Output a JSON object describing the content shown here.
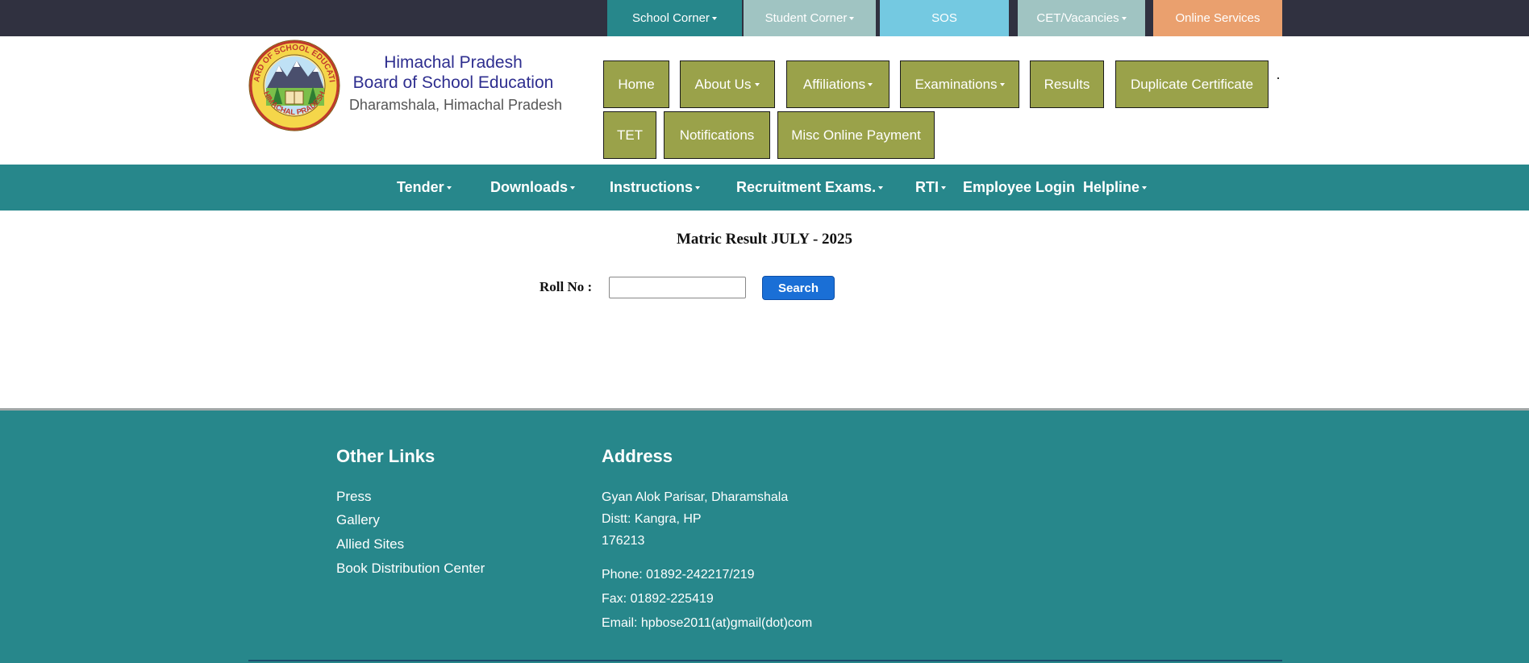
{
  "colors": {
    "topbar_bg": "#303140",
    "school_corner": "#27878b",
    "student_corner": "#a0c4c2",
    "sos": "#74c9e1",
    "cet": "#a0c4c2",
    "online": "#eaa06e",
    "nav_btn": "#9aa24a",
    "teal": "#27878b",
    "search_btn": "#1a6fd6"
  },
  "topbar": {
    "items": [
      {
        "label": "School Corner",
        "dropdown": true
      },
      {
        "label": "Student Corner",
        "dropdown": true
      },
      {
        "label": "SOS",
        "dropdown": false
      },
      {
        "label": "CET/Vacancies",
        "dropdown": true
      },
      {
        "label": "Online Services",
        "dropdown": false
      }
    ]
  },
  "brand": {
    "line1": "Himachal Pradesh",
    "line2": "Board of School Education",
    "line3": "Dharamshala, Himachal Pradesh",
    "logo_text_top": "BOARD OF SCHOOL EDUCATION",
    "logo_text_bottom": "HIMACHAL PRADESH"
  },
  "nav": {
    "items": [
      {
        "label": "Home",
        "dropdown": false
      },
      {
        "label": "About Us",
        "dropdown": true
      },
      {
        "label": "Affiliations",
        "dropdown": true
      },
      {
        "label": "Examinations",
        "dropdown": true
      },
      {
        "label": "Results",
        "dropdown": false
      },
      {
        "label": "Duplicate Certificate",
        "dropdown": false
      },
      {
        "label": "TET",
        "dropdown": false
      },
      {
        "label": "Notifications",
        "dropdown": false
      },
      {
        "label": "Misc Online Payment",
        "dropdown": false
      }
    ]
  },
  "secnav": {
    "items": [
      {
        "label": "Tender",
        "dropdown": true
      },
      {
        "label": "Downloads",
        "dropdown": true
      },
      {
        "label": "Instructions",
        "dropdown": true
      },
      {
        "label": "Recruitment Exams.",
        "dropdown": true
      },
      {
        "label": "RTI",
        "dropdown": true
      },
      {
        "label": "Employee Login",
        "dropdown": false
      },
      {
        "label": "Helpline",
        "dropdown": true
      }
    ]
  },
  "main": {
    "title": "Matric Result JULY - 2025",
    "roll_label": "Roll No :",
    "roll_value": "",
    "search_label": "Search"
  },
  "footer": {
    "other_links_heading": "Other Links",
    "links": [
      "Press",
      "Gallery",
      "Allied Sites",
      "Book Distribution Center"
    ],
    "address_heading": "Address",
    "address_lines": [
      "Gyan Alok Parisar, Dharamshala",
      "Distt: Kangra, HP",
      "176213"
    ],
    "phone": "Phone: 01892-242217/219",
    "fax": "Fax: 01892-225419",
    "email": "Email: hpbose2011(at)gmail(dot)com"
  }
}
